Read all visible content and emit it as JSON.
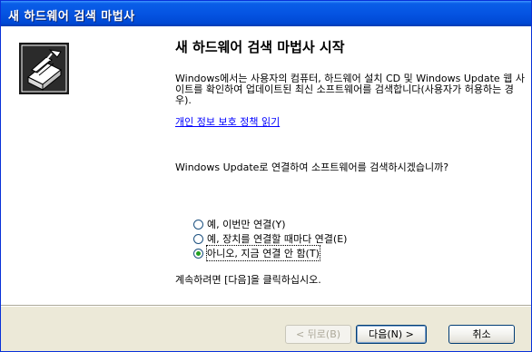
{
  "window": {
    "title": "새 하드웨어 검색 마법사"
  },
  "logo": {
    "icon": "hardware-wizard-icon"
  },
  "main": {
    "heading": "새 하드웨어 검색 마법사 시작",
    "description": "Windows에서는 사용자의 컴퓨터, 하드웨어 설치 CD 및 Windows Update 웹 사이트를 확인하여 업데이트된 최신 소프트웨어를 검색합니다(사용자가 허용하는 경우).",
    "privacy_link": "개인 정보 보호 정책 읽기",
    "question": "Windows Update로 연결하여 소프트웨어를 검색하시겠습니까?",
    "options": [
      {
        "label": "예, 이번만 연결(Y)",
        "checked": false
      },
      {
        "label": "예, 장치를 연결할 때마다 연결(E)",
        "checked": false
      },
      {
        "label": "아니오, 지금 연결 안 함(T)",
        "checked": true
      }
    ],
    "continue_text": "계속하려면 [다음]을 클릭하십시오."
  },
  "buttons": {
    "back": "< 뒤로(B)",
    "next": "다음(N) >",
    "cancel": "취소"
  },
  "colors": {
    "titlebar": "#0554e2",
    "dialog_bg": "#ece9d8",
    "link": "#0000ff"
  }
}
